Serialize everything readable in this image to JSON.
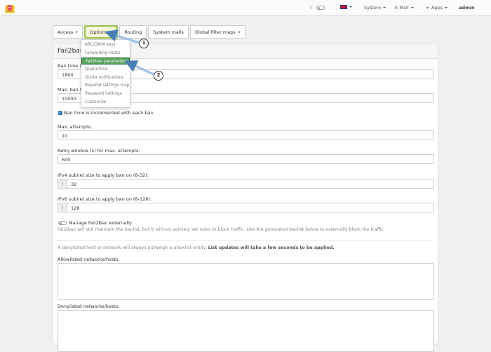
{
  "navbar": {
    "logo_icon": "mascot-logo-icon",
    "theme_icon": "moon-icon",
    "language_icon": "uk-flag-icon",
    "system_label": "System",
    "email_label": "E-Mail",
    "apps_label": "Apps",
    "user_label": "admin"
  },
  "tabs": {
    "access": "Access",
    "options": "Options",
    "routing": "Routing",
    "system_mails": "System mails",
    "global_filter_maps": "Global filter maps"
  },
  "options_menu": {
    "items": [
      "ARC/DKIM keys",
      "Forwarding Hosts",
      "Fail2ban parameters",
      "Quarantine",
      "Quota notifications",
      "Rspamd settings map",
      "Password Settings",
      "Customize"
    ],
    "active_index": 2
  },
  "panel": {
    "title": "Fail2ban",
    "ban_time_label": "Ban time (",
    "ban_time_value": "1800",
    "max_ban_time_label": "Max. ban t",
    "max_ban_time_value": "10000",
    "incremented_label": "Ban time is incremented with each ban",
    "max_attempts_label": "Max. attempts:",
    "max_attempts_value": "10",
    "retry_window_label": "Retry window (s) for max. attempts:",
    "retry_window_value": "600",
    "ipv4_label": "IPv4 subnet size to apply ban on (8-32):",
    "ipv4_addon": "/",
    "ipv4_value": "32",
    "ipv6_label": "IPv6 subnet size to apply ban on (8-128):",
    "ipv6_addon": "/",
    "ipv6_value": "128",
    "manage_label": "Manage Fail2Ban externally",
    "manage_help": "Fail2ban will still maintain the banlist, but it will not actively set rules to block traffic. Use the generated banlist below to externally block the traffic.",
    "denylist_note": "A denylisted host or network will always outweigh a allowlist entity.",
    "denylist_note_bold": "List updates will take a few seconds to be applied.",
    "allowlist_label": "Allowlisted networks/hosts:",
    "denylist_label": "Denylisted networks/hosts:"
  },
  "callouts": {
    "one": "1",
    "two": "2"
  },
  "colors": {
    "highlight_green": "#56a25d",
    "options_tab_border": "#9ac04b",
    "arrow_blue": "#4a7fb5"
  }
}
